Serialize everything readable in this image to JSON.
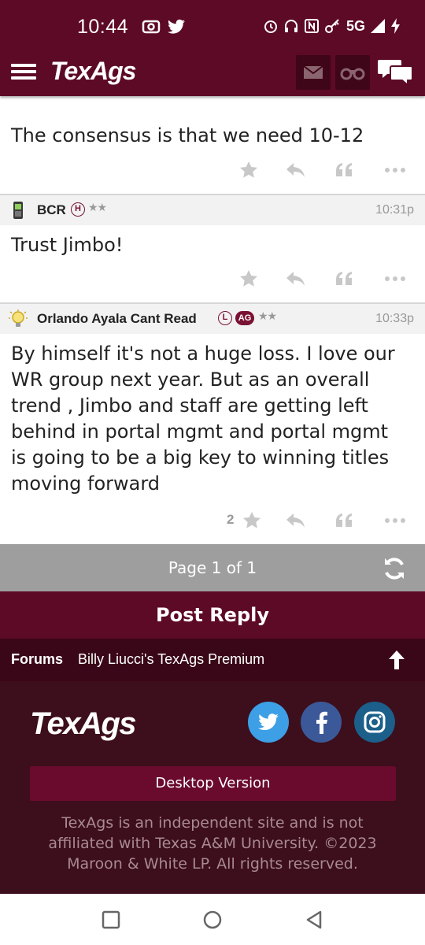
{
  "status": {
    "time": "10:44",
    "network": "5G"
  },
  "header": {
    "brand": "TexAgs",
    "icons": [
      "menu-icon",
      "mail-icon",
      "binoculars-icon",
      "chat-icon"
    ]
  },
  "posts": [
    {
      "body": "The consensus is that we need 10-12",
      "likes": ""
    },
    {
      "user": "BCR",
      "badges": [
        "H"
      ],
      "stars": "★★",
      "time": "10:31p",
      "avatar": "phone-icon",
      "body": "Trust Jimbo!",
      "likes": ""
    },
    {
      "user": "Orlando Ayala Cant Read",
      "badges": [
        "L",
        "AG"
      ],
      "stars": "★★",
      "time": "10:33p",
      "avatar": "lightbulb-icon",
      "body_lines": [
        "By himself it's not a huge loss. I love our",
        "WR group next year. But as an overall",
        "trend , Jimbo and staff are getting left",
        "behind in portal mgmt and portal mgmt",
        "is going to be a big key to winning titles",
        "moving forward"
      ],
      "likes": "2"
    }
  ],
  "pagination": {
    "text": "Page 1 of 1"
  },
  "post_reply": "Post Reply",
  "breadcrumb": {
    "forums": "Forums",
    "current": "Billy Liucci's TexAgs Premium"
  },
  "footer": {
    "brand": "TexAgs",
    "desktop": "Desktop Version",
    "disclaimer": "TexAgs is an independent site and is not affiliated with Texas A&M University. ©2023 Maroon & White LP. All rights reserved."
  },
  "colors": {
    "maroon": "#5d0a26",
    "footer": "#3d0e1b",
    "pager": "#9e9e9e"
  }
}
